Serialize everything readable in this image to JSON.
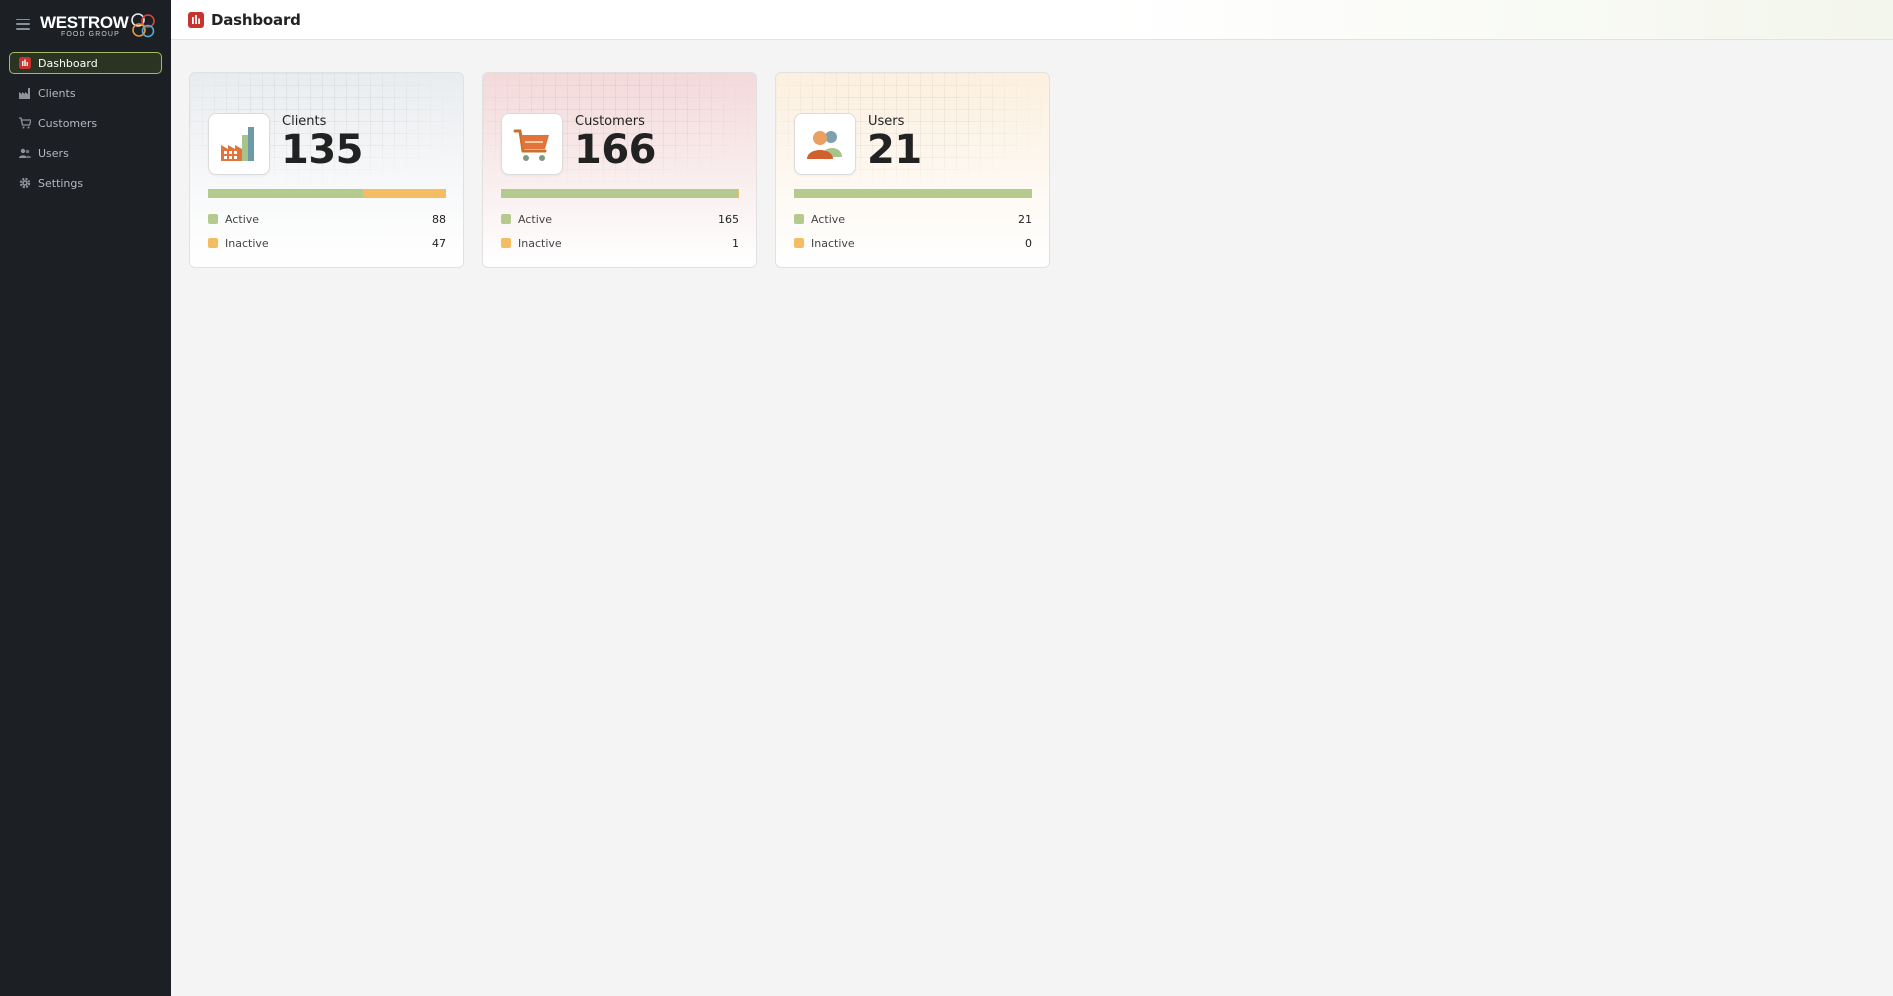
{
  "brand": {
    "name": "WESTROW",
    "sub": "FOOD GROUP"
  },
  "sidebar": {
    "items": [
      {
        "label": "Dashboard",
        "icon": "chart-icon",
        "active": true
      },
      {
        "label": "Clients",
        "icon": "factory-icon",
        "active": false
      },
      {
        "label": "Customers",
        "icon": "cart-icon",
        "active": false
      },
      {
        "label": "Users",
        "icon": "users-icon",
        "active": false
      },
      {
        "label": "Settings",
        "icon": "gear-icon",
        "active": false
      }
    ]
  },
  "header": {
    "title": "Dashboard"
  },
  "cards": [
    {
      "name": "Clients",
      "count": "135",
      "icon": "factory-icon",
      "active_label": "Active",
      "active": 88,
      "inactive_label": "Inactive",
      "inactive": 47
    },
    {
      "name": "Customers",
      "count": "166",
      "icon": "cart-icon",
      "active_label": "Active",
      "active": 165,
      "inactive_label": "Inactive",
      "inactive": 1
    },
    {
      "name": "Users",
      "count": "21",
      "icon": "users-icon",
      "active_label": "Active",
      "active": 21,
      "inactive_label": "Inactive",
      "inactive": 0
    }
  ],
  "colors": {
    "sidebar_bg": "#1c1f24",
    "accent": "#a6b863",
    "active_green": "#b4ca8e",
    "inactive_orange": "#f4bd61",
    "brand_red": "#c9332e"
  }
}
